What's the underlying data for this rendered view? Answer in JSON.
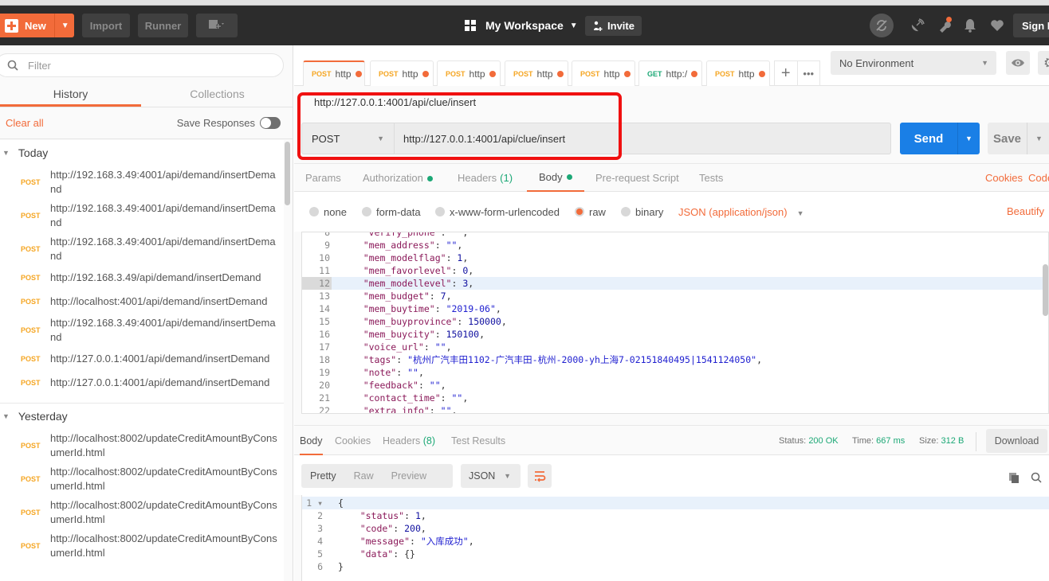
{
  "header": {
    "new_label": "New",
    "import_label": "Import",
    "runner_label": "Runner",
    "workspace_label": "My Workspace",
    "invite_label": "Invite",
    "signin_label": "Sign In",
    "accent_color": "#f26b3a"
  },
  "sidebar": {
    "filter_placeholder": "Filter",
    "tabs": [
      {
        "label": "History",
        "active": true
      },
      {
        "label": "Collections",
        "active": false
      }
    ],
    "clear_all_label": "Clear all",
    "save_responses_label": "Save Responses",
    "groups": [
      {
        "label": "Today",
        "items": [
          {
            "method": "POST",
            "url": "http://192.168.3.49:4001/api/demand/insertDemand"
          },
          {
            "method": "POST",
            "url": "http://192.168.3.49:4001/api/demand/insertDemand"
          },
          {
            "method": "POST",
            "url": "http://192.168.3.49:4001/api/demand/insertDemand"
          },
          {
            "method": "POST",
            "url": "http://192.168.3.49/api/demand/insertDemand"
          },
          {
            "method": "POST",
            "url": "http://localhost:4001/api/demand/insertDemand"
          },
          {
            "method": "POST",
            "url": "http://192.168.3.49:4001/api/demand/insertDemand"
          },
          {
            "method": "POST",
            "url": "http://127.0.0.1:4001/api/demand/insertDemand"
          },
          {
            "method": "POST",
            "url": "http://127.0.0.1:4001/api/demand/insertDemand"
          }
        ]
      },
      {
        "label": "Yesterday",
        "items": [
          {
            "method": "POST",
            "url": "http://localhost:8002/updateCreditAmountByConsumerId.html"
          },
          {
            "method": "POST",
            "url": "http://localhost:8002/updateCreditAmountByConsumerId.html"
          },
          {
            "method": "POST",
            "url": "http://localhost:8002/updateCreditAmountByConsumerId.html"
          },
          {
            "method": "POST",
            "url": "http://localhost:8002/updateCreditAmountByConsumerId.html"
          }
        ]
      }
    ]
  },
  "request_tabs": [
    {
      "method": "POST",
      "label": "http",
      "active": true
    },
    {
      "method": "POST",
      "label": "http",
      "active": false
    },
    {
      "method": "POST",
      "label": "http",
      "active": false
    },
    {
      "method": "POST",
      "label": "http",
      "active": false
    },
    {
      "method": "POST",
      "label": "http",
      "active": false
    },
    {
      "method": "GET",
      "label": "http:/",
      "active": false
    },
    {
      "method": "POST",
      "label": "http",
      "active": false
    }
  ],
  "environment": {
    "selected": "No Environment"
  },
  "request": {
    "name": "http://127.0.0.1:4001/api/clue/insert",
    "method": "POST",
    "url": "http://127.0.0.1:4001/api/clue/insert",
    "send_label": "Send",
    "save_label": "Save",
    "subtabs": [
      {
        "label": "Params"
      },
      {
        "label": "Authorization",
        "dot": true
      },
      {
        "label": "Headers",
        "count": "(1)"
      },
      {
        "label": "Body",
        "dot": true,
        "active": true
      },
      {
        "label": "Pre-request Script"
      },
      {
        "label": "Tests"
      }
    ],
    "cookies_label": "Cookies",
    "code_label": "Code",
    "body_types": [
      {
        "label": "none",
        "selected": false
      },
      {
        "label": "form-data",
        "selected": false
      },
      {
        "label": "x-www-form-urlencoded",
        "selected": false
      },
      {
        "label": "raw",
        "selected": true
      },
      {
        "label": "binary",
        "selected": false
      }
    ],
    "content_type": "JSON (application/json)",
    "beautify_label": "Beautify",
    "body_lines": [
      {
        "n": "8",
        "key": "\"verify_phone\"",
        "val": "\"\"",
        "type": "s"
      },
      {
        "n": "9",
        "key": "\"mem_address\"",
        "val": "\"\"",
        "type": "s"
      },
      {
        "n": "10",
        "key": "\"mem_modelflag\"",
        "val": "1",
        "type": "n"
      },
      {
        "n": "11",
        "key": "\"mem_favorlevel\"",
        "val": "0",
        "type": "n"
      },
      {
        "n": "12",
        "key": "\"mem_modellevel\"",
        "val": "3",
        "type": "n",
        "active": true
      },
      {
        "n": "13",
        "key": "\"mem_budget\"",
        "val": "7",
        "type": "n"
      },
      {
        "n": "14",
        "key": "\"mem_buytime\"",
        "val": "\"2019-06\"",
        "type": "s"
      },
      {
        "n": "15",
        "key": "\"mem_buyprovince\"",
        "val": "150000",
        "type": "n"
      },
      {
        "n": "16",
        "key": "\"mem_buycity\"",
        "val": "150100",
        "type": "n"
      },
      {
        "n": "17",
        "key": "\"voice_url\"",
        "val": "\"\"",
        "type": "s"
      },
      {
        "n": "18",
        "key": "\"tags\"",
        "val": "\"杭州广汽丰田1102-广汽丰田-杭州-2000-yh上海7-02151840495|1541124050\"",
        "type": "s"
      },
      {
        "n": "19",
        "key": "\"note\"",
        "val": "\"\"",
        "type": "s"
      },
      {
        "n": "20",
        "key": "\"feedback\"",
        "val": "\"\"",
        "type": "s"
      },
      {
        "n": "21",
        "key": "\"contact_time\"",
        "val": "\"\"",
        "type": "s"
      },
      {
        "n": "22",
        "key": "\"extra_info\"",
        "val": "\"\"",
        "type": "s"
      }
    ]
  },
  "response": {
    "tabs": [
      {
        "label": "Body",
        "active": true
      },
      {
        "label": "Cookies"
      },
      {
        "label": "Headers",
        "count": "(8)"
      },
      {
        "label": "Test Results"
      }
    ],
    "status_label": "Status:",
    "status_value": "200 OK",
    "time_label": "Time:",
    "time_value": "667 ms",
    "size_label": "Size:",
    "size_value": "312 B",
    "download_label": "Download",
    "view_modes": [
      {
        "label": "Pretty",
        "active": true
      },
      {
        "label": "Raw"
      },
      {
        "label": "Preview"
      }
    ],
    "format": "JSON",
    "body_lines": [
      {
        "n": "1",
        "text": "{"
      },
      {
        "n": "2",
        "key": "\"status\"",
        "val": "1",
        "type": "n"
      },
      {
        "n": "3",
        "key": "\"code\"",
        "val": "200",
        "type": "n"
      },
      {
        "n": "4",
        "key": "\"message\"",
        "val": "\"入库成功\"",
        "type": "s"
      },
      {
        "n": "5",
        "key": "\"data\"",
        "val": "{}",
        "type": "p",
        "last": true
      },
      {
        "n": "6",
        "text": "}"
      }
    ]
  }
}
